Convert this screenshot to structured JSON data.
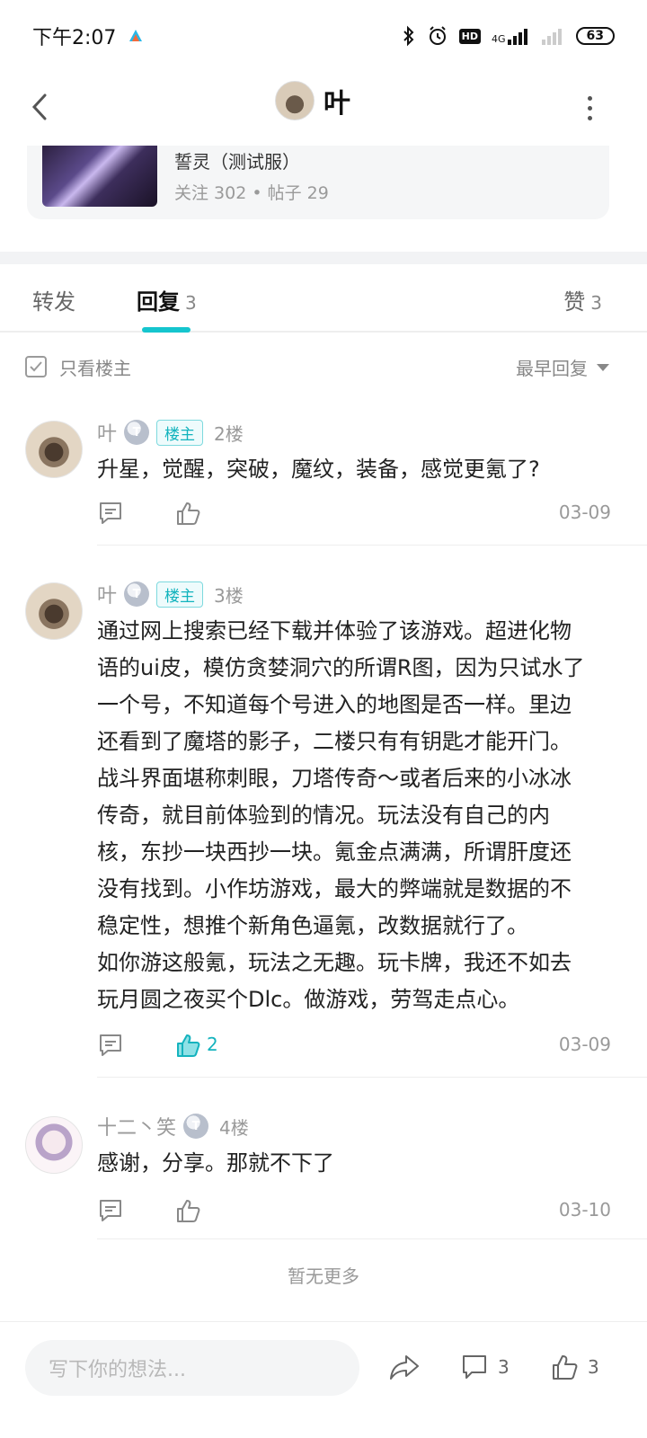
{
  "status_bar": {
    "time": "下午2:07",
    "network": "4G",
    "hd": "HD",
    "battery": "63"
  },
  "header": {
    "title": "叶"
  },
  "forum": {
    "name": "誓灵（测试服）",
    "stats": "关注 302 • 帖子 29"
  },
  "tabs": {
    "repost_label": "转发",
    "reply_label": "回复",
    "reply_count": "3",
    "like_label": "赞",
    "like_count": "3"
  },
  "filter": {
    "only_op_label": "只看楼主",
    "sort_label": "最早回复"
  },
  "replies": [
    {
      "user": "叶",
      "level": "T",
      "op_badge": "楼主",
      "floor": "2楼",
      "content": "升星，觉醒，突破，魔纹，装备，感觉更氪了?",
      "likes": "",
      "date": "03-09",
      "liked": false
    },
    {
      "user": "叶",
      "level": "T",
      "op_badge": "楼主",
      "floor": "3楼",
      "content": "通过网上搜索已经下载并体验了该游戏。超进化物\n语的ui皮，模仿贪婪洞穴的所谓R图，因为只试水了\n一个号，不知道每个号进入的地图是否一样。里边\n还看到了魔塔的影子，二楼只有有钥匙才能开门。\n战斗界面堪称刺眼，刀塔传奇～或者后来的小冰冰\n传奇，就目前体验到的情况。玩法没有自己的内\n核，东抄一块西抄一块。氪金点满满，所谓肝度还\n没有找到。小作坊游戏，最大的弊端就是数据的不\n稳定性，想推个新角色逼氪，改数据就行了。\n如你游这般氪，玩法之无趣。玩卡牌，我还不如去\n玩月圆之夜买个Dlc。做游戏，劳驾走点心。",
      "likes": "2",
      "date": "03-09",
      "liked": true
    },
    {
      "user": "十二丶笑",
      "level": "T",
      "op_badge": "",
      "floor": "4楼",
      "content": "感谢，分享。那就不下了",
      "likes": "",
      "date": "03-10",
      "liked": false
    }
  ],
  "footer": {
    "no_more": "暂无更多"
  },
  "bottom_bar": {
    "input_placeholder": "写下你的想法...",
    "comment_count": "3",
    "like_count": "3"
  },
  "colors": {
    "accent": "#15c5ce",
    "like_active": "#15b3be"
  }
}
